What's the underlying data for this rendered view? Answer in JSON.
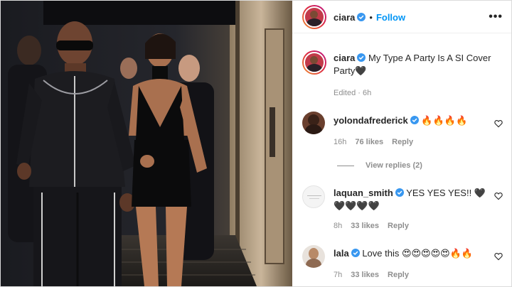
{
  "post": {
    "author": "ciara",
    "follow_label": "Follow",
    "separator": "•",
    "more_label": "•••",
    "caption": "My Type A Party Is A SI Cover Party",
    "caption_emoji": "🖤",
    "caption_meta": "Edited · 6h"
  },
  "comments": [
    {
      "username": "yolondafrederick",
      "text": "🔥🔥🔥🔥",
      "time": "16h",
      "likes": "76 likes",
      "reply": "Reply",
      "view_replies": "View replies (2)"
    },
    {
      "username": "laquan_smith",
      "text": "YES YES YES!! 🖤",
      "text_line2": "🖤🖤🖤🖤",
      "time": "8h",
      "likes": "33 likes",
      "reply": "Reply"
    },
    {
      "username": "lala",
      "text": "Love this 😍😍😍😍😍🔥🔥",
      "time": "7h",
      "likes": "33 likes",
      "reply": "Reply"
    }
  ],
  "colors": {
    "link_blue": "#0095f6",
    "verified_blue": "#3897f0",
    "meta_gray": "#8e8e8e"
  },
  "icons": [
    "verified-badge-icon",
    "more-options-icon",
    "heart-icon"
  ]
}
